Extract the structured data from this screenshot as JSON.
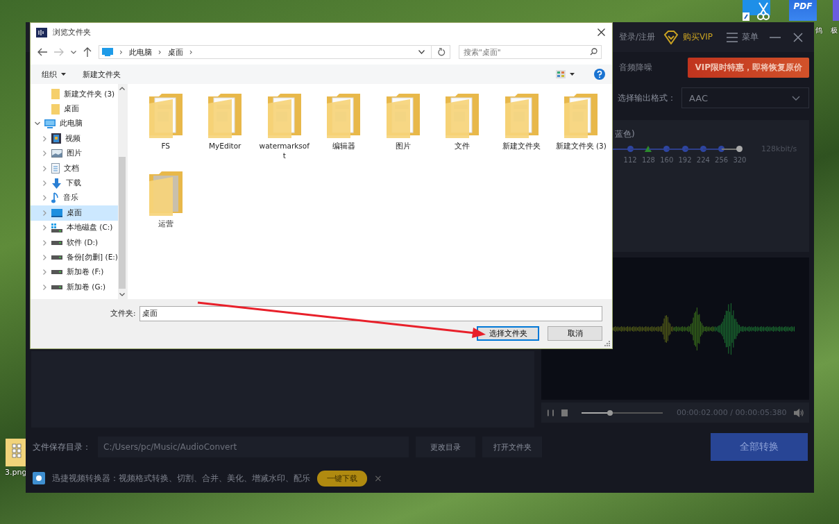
{
  "desktop": {
    "top_icons": [
      {
        "kind": "scissors"
      },
      {
        "kind": "pdf",
        "text": "PDF",
        "label": "鸽"
      },
      {
        "kind": "app",
        "label": "极"
      }
    ],
    "file_icon": {
      "label": "3.png"
    }
  },
  "app": {
    "account": "登录/注册",
    "vip": "购买VIP",
    "menu": "菜单",
    "tab": "音频降噪",
    "banner": "VIP限时特惠，即将恢复原价",
    "format_label": "选择输出格式：",
    "format_value": "AAC",
    "quality_label": "蓝色)",
    "bitrates": [
      {
        "label": "112",
        "selected": false,
        "enabled": true
      },
      {
        "label": "128",
        "selected": true,
        "enabled": true
      },
      {
        "label": "160",
        "selected": false,
        "enabled": true
      },
      {
        "label": "192",
        "selected": false,
        "enabled": true
      },
      {
        "label": "224",
        "selected": false,
        "enabled": true
      },
      {
        "label": "256",
        "selected": false,
        "enabled": true
      },
      {
        "label": "320",
        "selected": false,
        "enabled": false
      }
    ],
    "bitrate_reading": "128kbit/s",
    "player": {
      "level": 0.35,
      "time": "00:00:02.000 / 00:00:05:380"
    },
    "save_label": "文件保存目录：",
    "save_path": "C:/Users/pc/Music/AudioConvert",
    "change_dir": "更改目录",
    "open_folder": "打开文件夹",
    "convert_all": "全部转换",
    "ad": {
      "text": "迅捷视频转换器：视频格式转换、切割、合并、美化、增减水印、配乐",
      "button": "一键下载",
      "close": "×"
    }
  },
  "dialog": {
    "title": "浏览文件夹",
    "breadcrumb": [
      {
        "sep": "›",
        "label": "此电脑"
      },
      {
        "sep": "›",
        "label": "桌面"
      }
    ],
    "breadcrumb_end": "›",
    "search_placeholder": "搜索\"桌面\"",
    "organize": "组织",
    "new_folder": "新建文件夹",
    "tree": [
      {
        "children": [
          {
            "label": "新建文件夹 (3)",
            "kind": "folder",
            "selected": false
          },
          {
            "label": "桌面",
            "kind": "folder",
            "selected": false
          }
        ]
      },
      {
        "label": "此电脑",
        "kind": "pc",
        "selected": false,
        "expanded": true,
        "children": [
          {
            "label": "视频",
            "kind": "video",
            "selected": false,
            "expanded": false
          },
          {
            "label": "图片",
            "kind": "picture",
            "selected": false,
            "expanded": false
          },
          {
            "label": "文档",
            "kind": "document",
            "selected": false,
            "expanded": false
          },
          {
            "label": "下载",
            "kind": "download",
            "selected": false,
            "expanded": false
          },
          {
            "label": "音乐",
            "kind": "music",
            "selected": false,
            "expanded": false
          },
          {
            "label": "桌面",
            "kind": "desktop",
            "selected": true,
            "expanded": false
          },
          {
            "label": "本地磁盘 (C:)",
            "kind": "system-drive",
            "selected": false,
            "expanded": false
          },
          {
            "label": "软件 (D:)",
            "kind": "drive",
            "selected": false,
            "expanded": false
          },
          {
            "label": "备份[勿删] (E:)",
            "kind": "drive",
            "selected": false,
            "expanded": false
          },
          {
            "label": "新加卷 (F:)",
            "kind": "drive",
            "selected": false,
            "expanded": false
          },
          {
            "label": "新加卷 (G:)",
            "kind": "drive",
            "selected": false,
            "expanded": false
          }
        ]
      }
    ],
    "files": [
      {
        "label": "FS",
        "kind": "folder"
      },
      {
        "label": "MyEditor",
        "kind": "folder"
      },
      {
        "label": "watermarksoft",
        "kind": "folder"
      },
      {
        "label": "编辑器",
        "kind": "folder"
      },
      {
        "label": "图片",
        "kind": "folder"
      },
      {
        "label": "文件",
        "kind": "folder"
      },
      {
        "label": "新建文件夹",
        "kind": "folder"
      },
      {
        "label": "新建文件夹 (3)",
        "kind": "folder"
      },
      {
        "label": "运营",
        "kind": "folder-plain"
      }
    ],
    "folder_label": "文件夹:",
    "folder_value": "桌面",
    "buttons": [
      {
        "label": "选择文件夹",
        "default": true
      },
      {
        "label": "取消",
        "default": false
      }
    ]
  }
}
